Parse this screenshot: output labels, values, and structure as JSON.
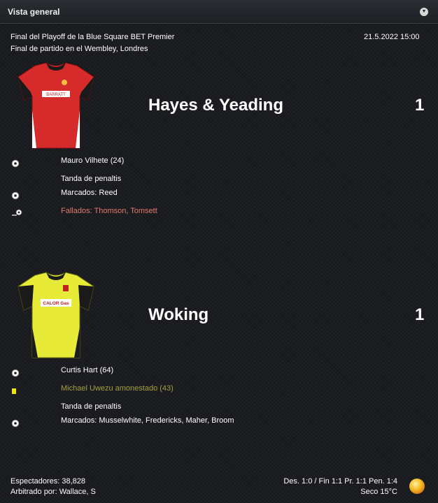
{
  "header": {
    "title": "Vista general",
    "toggle_icon": "chevron-down-icon"
  },
  "match": {
    "competition": "Final del Playoff de la Blue Square BET Premier",
    "venue": "Final de partido en el Wembley, Londres",
    "datetime": "21.5.2022 15:00"
  },
  "home": {
    "name": "Hayes & Yeading",
    "score": "1",
    "kit_text": "BARRATT",
    "events": {
      "goal": "Mauro Vilhete (24)",
      "shootout_title": "Tanda de penaltis",
      "scored": "Marcados: Reed",
      "missed": "Fallados: Thomson, Tomsett"
    }
  },
  "away": {
    "name": "Woking",
    "score": "1",
    "kit_text": "CALOR Gas",
    "events": {
      "goal": "Curtis Hart (64)",
      "booking": "Michael Uwezu amonestado (43)",
      "shootout_title": "Tanda de penaltis",
      "scored": "Marcados: Musselwhite, Fredericks, Maher, Broom"
    }
  },
  "footer": {
    "attendance": "Espectadores: 38,828",
    "referee": "Arbitrado por: Wallace, S",
    "score_summary": "Des. 1:0 / Fin 1:1 Pr. 1:1 Pen. 1:4",
    "weather": "Seco 15°C",
    "weather_icon": "sun-icon"
  },
  "colors": {
    "home_kit": "#d62b2b",
    "away_kit": "#e8ea38",
    "missed_text": "#e27b6e",
    "booking_text": "#a8a03c",
    "yellow_card": "#f2e600"
  }
}
